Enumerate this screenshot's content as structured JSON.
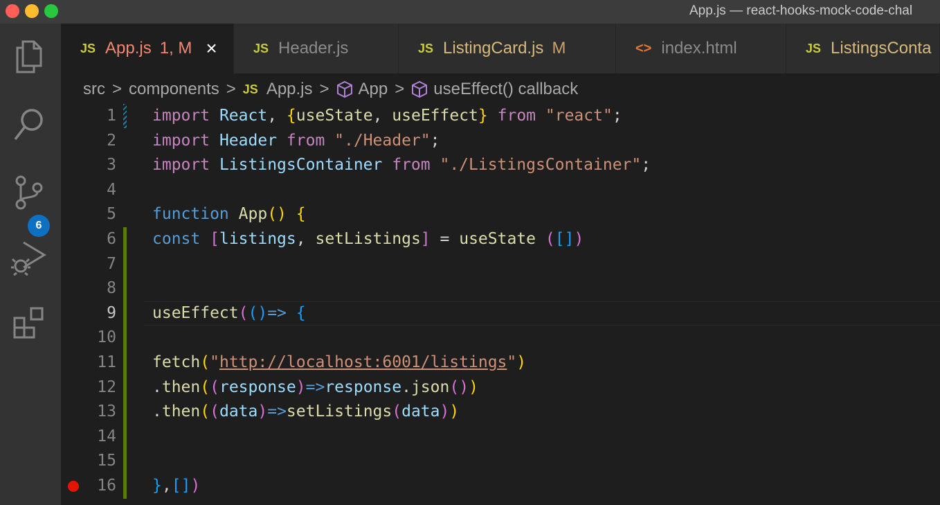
{
  "window": {
    "title": "App.js — react-hooks-mock-code-chal"
  },
  "activity_bar": {
    "items": [
      "explorer-icon",
      "search-icon",
      "source-control-icon",
      "run-debug-icon",
      "extensions-icon"
    ],
    "source_control_badge": "6"
  },
  "tabs": [
    {
      "label": "App.js",
      "badge": "JS",
      "status": "1, M",
      "active": true
    },
    {
      "label": "Header.js",
      "badge": "JS",
      "status": "",
      "active": false
    },
    {
      "label": "ListingCard.js",
      "badge": "JS",
      "status": "M",
      "active": false
    },
    {
      "label": "index.html",
      "badge": "<>",
      "status": "",
      "active": false
    },
    {
      "label": "ListingsConta",
      "badge": "JS",
      "status": "",
      "active": false
    }
  ],
  "breadcrumb": {
    "items": [
      "src",
      "components",
      "App.js",
      "App",
      "useEffect() callback"
    ],
    "file_badge": "JS",
    "separator": ">"
  },
  "editor": {
    "current_line": 9,
    "breakpoint_line": 16,
    "line_numbers": [
      "1",
      "2",
      "3",
      "4",
      "5",
      "6",
      "7",
      "8",
      "9",
      "10",
      "11",
      "12",
      "13",
      "14",
      "15",
      "16"
    ],
    "lines": [
      "import React, {useState, useEffect} from \"react\";",
      "import Header from \"./Header\";",
      "import ListingsContainer from \"./ListingsContainer\";",
      "",
      "function App() {",
      "const [listings, setListings] = useState ([])",
      "",
      "",
      "useEffect(()=> {",
      "",
      "fetch(\"http://localhost:6001/listings\")",
      ".then((response)=>response.json())",
      ".then((data)=>setListings(data))",
      "",
      "",
      "},[])"
    ]
  },
  "colors": {
    "keyword": "#c586c0",
    "storage": "#569cd6",
    "variable": "#9cdcfe",
    "function": "#dcdcaa",
    "string": "#ce9178",
    "bracket1": "#ffd700",
    "bracket2": "#da70d6",
    "bracket3": "#179fff",
    "active_tab_text": "#f48771"
  }
}
